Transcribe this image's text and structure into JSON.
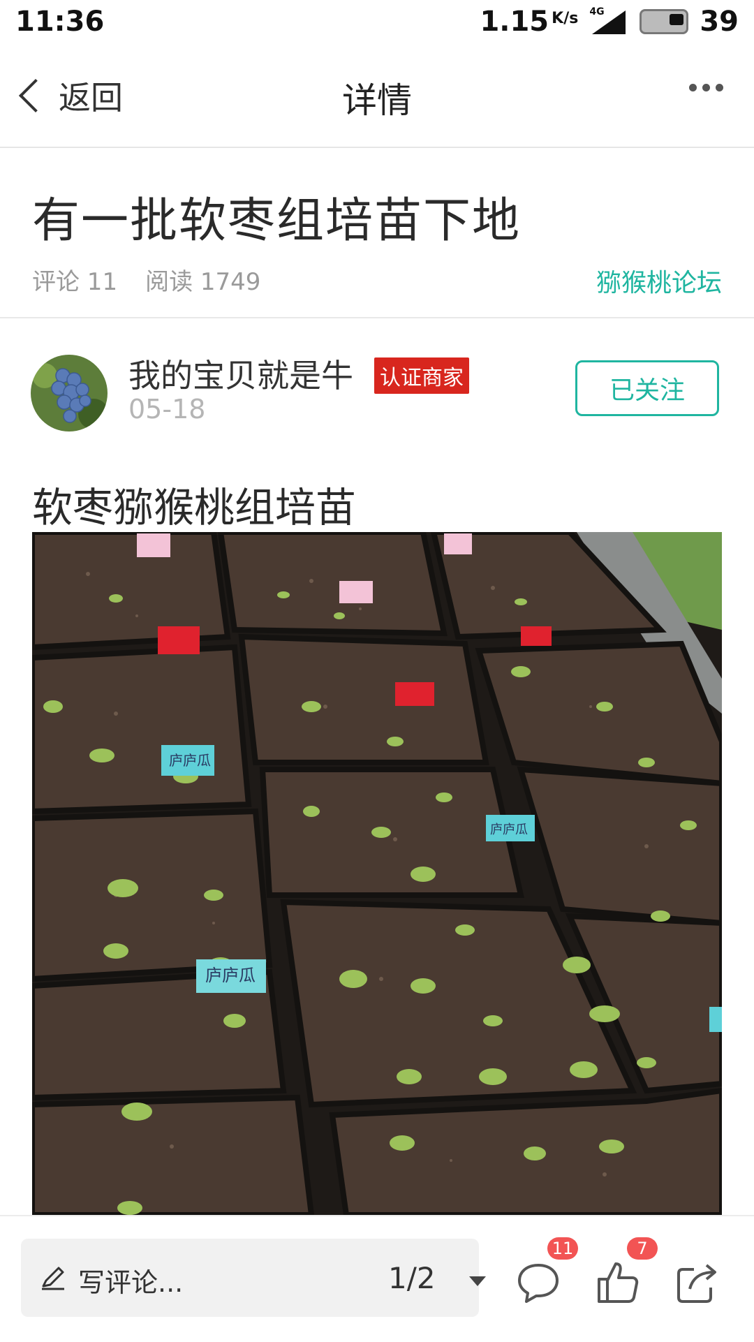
{
  "status_bar": {
    "time": "11:36",
    "speed": "1.15",
    "speed_unit": "K/s",
    "network": "4G",
    "battery": "39"
  },
  "nav": {
    "back_label": "返回",
    "title": "详情"
  },
  "article": {
    "title": "有一批软枣组培苗下地",
    "comments_label": "评论 11",
    "reads_label": "阅读 1749",
    "forum": "猕猴桃论坛"
  },
  "author": {
    "name": "我的宝贝就是牛",
    "badge": "认证商家",
    "date": "05-18",
    "follow_label": "已关注"
  },
  "content": {
    "section_title": "软枣猕猴桃组培苗",
    "photo_tags": [
      "庐庐瓜",
      "庐庐瓜",
      "庐庐瓜"
    ]
  },
  "bottom_bar": {
    "comment_placeholder": "写评论...",
    "page_indicator": "1/2",
    "comment_count": "11",
    "like_count": "7"
  },
  "colors": {
    "accent": "#1fb5a0",
    "badge_red": "#d8261e",
    "count_red": "#f25454"
  }
}
